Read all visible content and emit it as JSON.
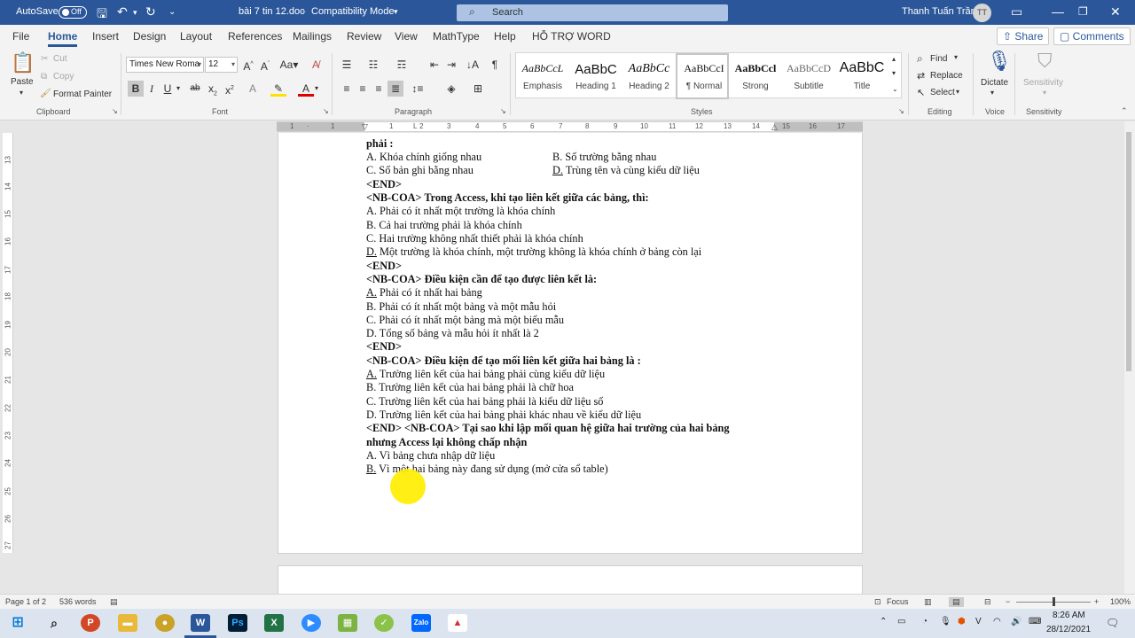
{
  "titlebar": {
    "autosave": "AutoSave",
    "toggle": "Off",
    "doc_title": "bài 7 tin 12.doc",
    "mode": "Compatibility Mode",
    "search_placeholder": "Search",
    "user_name": "Thanh Tuấn Trần",
    "initials": "TT"
  },
  "menu": {
    "items": [
      "File",
      "Home",
      "Insert",
      "Design",
      "Layout",
      "References",
      "Mailings",
      "Review",
      "View",
      "MathType",
      "Help",
      "HỖ TRỢ WORD"
    ],
    "share": "Share",
    "comments": "Comments"
  },
  "ribbon": {
    "clipboard": {
      "paste": "Paste",
      "cut": "Cut",
      "copy": "Copy",
      "format_painter": "Format Painter",
      "label": "Clipboard"
    },
    "font": {
      "family": "Times New Roma",
      "size": "12",
      "label": "Font"
    },
    "paragraph": {
      "label": "Paragraph"
    },
    "styles": {
      "label": "Styles",
      "items": [
        {
          "preview": "AaBbCcL",
          "name": "Emphasis"
        },
        {
          "preview": "AaBbC",
          "name": "Heading 1"
        },
        {
          "preview": "AaBbCc",
          "name": "Heading 2"
        },
        {
          "preview": "AaBbCcI",
          "name": "¶ Normal"
        },
        {
          "preview": "AaBbCcl",
          "name": "Strong"
        },
        {
          "preview": "AaBbCcD",
          "name": "Subtitle"
        },
        {
          "preview": "AaBbC",
          "name": "Title"
        }
      ]
    },
    "editing": {
      "find": "Find",
      "replace": "Replace",
      "select": "Select",
      "label": "Editing"
    },
    "voice": {
      "dictate": "Dictate",
      "label": "Voice"
    },
    "sensitivity": {
      "button": "Sensitivity",
      "label": "Sensitivity"
    }
  },
  "ruler": {
    "h": [
      "1",
      "2",
      "1",
      "1",
      "2",
      "3",
      "4",
      "5",
      "6",
      "7",
      "8",
      "9",
      "10",
      "11",
      "12",
      "13",
      "14",
      "15",
      "16",
      "17"
    ],
    "v": [
      "12",
      "13",
      "14",
      "15",
      "16",
      "17",
      "18",
      "19",
      "20",
      "21",
      "22",
      "23",
      "24",
      "25",
      "26",
      "27"
    ]
  },
  "document": {
    "lines": [
      {
        "parts": [
          {
            "t": "phải :",
            "b": true
          }
        ]
      },
      {
        "parts": [
          {
            "t": "A. Khóa chính giống nhau"
          }
        ],
        "col2": [
          {
            "t": "B. Số trường bằng nhau"
          }
        ]
      },
      {
        "parts": [
          {
            "t": "C. Số bản ghi bằng nhau"
          }
        ],
        "col2": [
          {
            "t": "D.",
            "u": true
          },
          {
            "t": " Trùng tên và cùng kiểu dữ liệu"
          }
        ]
      },
      {
        "parts": [
          {
            "t": "<END>",
            "b": true
          }
        ]
      },
      {
        "parts": [
          {
            "t": " <NB-COA> Trong Access, khi tạo liên kết giữa các bảng, thì:",
            "b": true
          }
        ]
      },
      {
        "parts": [
          {
            "t": "A. Phải có ít nhất một trường là khóa chính"
          }
        ]
      },
      {
        "parts": [
          {
            "t": "B. Cả hai trường phải là khóa chính"
          }
        ]
      },
      {
        "parts": [
          {
            "t": "C. Hai trường không nhất thiết phải là khóa chính"
          }
        ]
      },
      {
        "parts": [
          {
            "t": "D.",
            "u": true
          },
          {
            "t": " Một trường là khóa chính, một trường không là khóa chính ở bảng còn lại"
          }
        ]
      },
      {
        "parts": [
          {
            "t": "<END>",
            "b": true
          }
        ]
      },
      {
        "parts": [
          {
            "t": "<NB-COA> Điều kiện cần để tạo được liên kết là:",
            "b": true
          }
        ]
      },
      {
        "parts": [
          {
            "t": "A.",
            "u": true
          },
          {
            "t": " Phải có ít nhất hai bảng"
          }
        ]
      },
      {
        "parts": [
          {
            "t": "B. Phải có ít nhất một bảng và một mẫu hỏi"
          }
        ]
      },
      {
        "parts": [
          {
            "t": "C. Phải có ít nhất một bảng mà một biểu mẫu"
          }
        ]
      },
      {
        "parts": [
          {
            "t": "D. Tổng số bảng và mẫu hỏi ít nhất là 2"
          }
        ]
      },
      {
        "parts": [
          {
            "t": "<END>",
            "b": true
          }
        ]
      },
      {
        "parts": [
          {
            "t": "<NB-COA> Điều kiện để tạo mối liên kết giữa hai bảng là :",
            "b": true
          }
        ]
      },
      {
        "parts": [
          {
            "t": "A.",
            "u": true
          },
          {
            "t": " Trường liên kết của hai bảng phải cùng kiểu dữ liệu"
          }
        ]
      },
      {
        "parts": [
          {
            "t": "B. Trường liên kết của hai bảng phải là chữ hoa"
          }
        ]
      },
      {
        "parts": [
          {
            "t": "C. Trường liên kết của hai bảng phải là kiểu dữ liệu số"
          }
        ]
      },
      {
        "parts": [
          {
            "t": "D. Trường liên kết của hai bảng phải khác nhau về kiểu dữ liệu"
          }
        ]
      },
      {
        "parts": [
          {
            "t": "<END> <NB-COA> Tại sao khi lập mối quan hệ giữa hai trường của hai bảng",
            "b": true
          }
        ]
      },
      {
        "parts": [
          {
            "t": "nhưng Access lại không chấp nhận",
            "b": true
          }
        ]
      },
      {
        "parts": [
          {
            "t": "A. Vì bảng chưa nhập dữ liệu"
          }
        ]
      },
      {
        "parts": [
          {
            "t": "B.",
            "u": true
          },
          {
            "t": " Vì một hai bảng này đang sử dụng (mở cửa sổ table)"
          }
        ]
      }
    ]
  },
  "status": {
    "page": "Page 1 of 2",
    "words": "536 words",
    "focus": "Focus",
    "zoom": "100%"
  },
  "taskbar": {
    "time": "8:26 AM",
    "date": "28/12/2021"
  }
}
